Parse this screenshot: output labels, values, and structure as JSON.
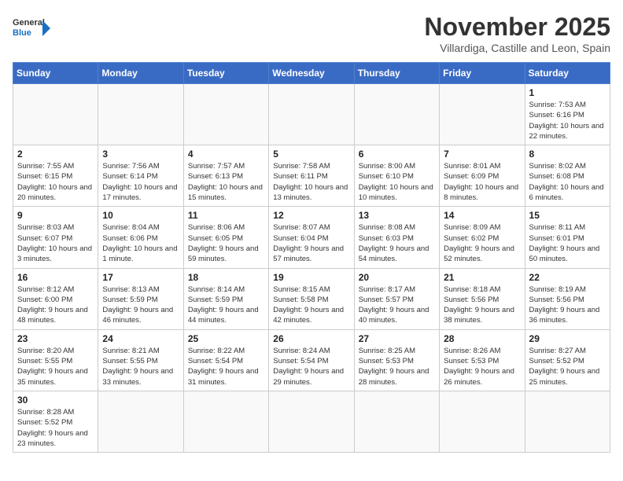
{
  "header": {
    "logo_general": "General",
    "logo_blue": "Blue",
    "month_title": "November 2025",
    "location": "Villardiga, Castille and Leon, Spain"
  },
  "weekdays": [
    "Sunday",
    "Monday",
    "Tuesday",
    "Wednesday",
    "Thursday",
    "Friday",
    "Saturday"
  ],
  "weeks": [
    [
      {
        "day": "",
        "info": ""
      },
      {
        "day": "",
        "info": ""
      },
      {
        "day": "",
        "info": ""
      },
      {
        "day": "",
        "info": ""
      },
      {
        "day": "",
        "info": ""
      },
      {
        "day": "",
        "info": ""
      },
      {
        "day": "1",
        "info": "Sunrise: 7:53 AM\nSunset: 6:16 PM\nDaylight: 10 hours and 22 minutes."
      }
    ],
    [
      {
        "day": "2",
        "info": "Sunrise: 7:55 AM\nSunset: 6:15 PM\nDaylight: 10 hours and 20 minutes."
      },
      {
        "day": "3",
        "info": "Sunrise: 7:56 AM\nSunset: 6:14 PM\nDaylight: 10 hours and 17 minutes."
      },
      {
        "day": "4",
        "info": "Sunrise: 7:57 AM\nSunset: 6:13 PM\nDaylight: 10 hours and 15 minutes."
      },
      {
        "day": "5",
        "info": "Sunrise: 7:58 AM\nSunset: 6:11 PM\nDaylight: 10 hours and 13 minutes."
      },
      {
        "day": "6",
        "info": "Sunrise: 8:00 AM\nSunset: 6:10 PM\nDaylight: 10 hours and 10 minutes."
      },
      {
        "day": "7",
        "info": "Sunrise: 8:01 AM\nSunset: 6:09 PM\nDaylight: 10 hours and 8 minutes."
      },
      {
        "day": "8",
        "info": "Sunrise: 8:02 AM\nSunset: 6:08 PM\nDaylight: 10 hours and 6 minutes."
      }
    ],
    [
      {
        "day": "9",
        "info": "Sunrise: 8:03 AM\nSunset: 6:07 PM\nDaylight: 10 hours and 3 minutes."
      },
      {
        "day": "10",
        "info": "Sunrise: 8:04 AM\nSunset: 6:06 PM\nDaylight: 10 hours and 1 minute."
      },
      {
        "day": "11",
        "info": "Sunrise: 8:06 AM\nSunset: 6:05 PM\nDaylight: 9 hours and 59 minutes."
      },
      {
        "day": "12",
        "info": "Sunrise: 8:07 AM\nSunset: 6:04 PM\nDaylight: 9 hours and 57 minutes."
      },
      {
        "day": "13",
        "info": "Sunrise: 8:08 AM\nSunset: 6:03 PM\nDaylight: 9 hours and 54 minutes."
      },
      {
        "day": "14",
        "info": "Sunrise: 8:09 AM\nSunset: 6:02 PM\nDaylight: 9 hours and 52 minutes."
      },
      {
        "day": "15",
        "info": "Sunrise: 8:11 AM\nSunset: 6:01 PM\nDaylight: 9 hours and 50 minutes."
      }
    ],
    [
      {
        "day": "16",
        "info": "Sunrise: 8:12 AM\nSunset: 6:00 PM\nDaylight: 9 hours and 48 minutes."
      },
      {
        "day": "17",
        "info": "Sunrise: 8:13 AM\nSunset: 5:59 PM\nDaylight: 9 hours and 46 minutes."
      },
      {
        "day": "18",
        "info": "Sunrise: 8:14 AM\nSunset: 5:59 PM\nDaylight: 9 hours and 44 minutes."
      },
      {
        "day": "19",
        "info": "Sunrise: 8:15 AM\nSunset: 5:58 PM\nDaylight: 9 hours and 42 minutes."
      },
      {
        "day": "20",
        "info": "Sunrise: 8:17 AM\nSunset: 5:57 PM\nDaylight: 9 hours and 40 minutes."
      },
      {
        "day": "21",
        "info": "Sunrise: 8:18 AM\nSunset: 5:56 PM\nDaylight: 9 hours and 38 minutes."
      },
      {
        "day": "22",
        "info": "Sunrise: 8:19 AM\nSunset: 5:56 PM\nDaylight: 9 hours and 36 minutes."
      }
    ],
    [
      {
        "day": "23",
        "info": "Sunrise: 8:20 AM\nSunset: 5:55 PM\nDaylight: 9 hours and 35 minutes."
      },
      {
        "day": "24",
        "info": "Sunrise: 8:21 AM\nSunset: 5:55 PM\nDaylight: 9 hours and 33 minutes."
      },
      {
        "day": "25",
        "info": "Sunrise: 8:22 AM\nSunset: 5:54 PM\nDaylight: 9 hours and 31 minutes."
      },
      {
        "day": "26",
        "info": "Sunrise: 8:24 AM\nSunset: 5:54 PM\nDaylight: 9 hours and 29 minutes."
      },
      {
        "day": "27",
        "info": "Sunrise: 8:25 AM\nSunset: 5:53 PM\nDaylight: 9 hours and 28 minutes."
      },
      {
        "day": "28",
        "info": "Sunrise: 8:26 AM\nSunset: 5:53 PM\nDaylight: 9 hours and 26 minutes."
      },
      {
        "day": "29",
        "info": "Sunrise: 8:27 AM\nSunset: 5:52 PM\nDaylight: 9 hours and 25 minutes."
      }
    ],
    [
      {
        "day": "30",
        "info": "Sunrise: 8:28 AM\nSunset: 5:52 PM\nDaylight: 9 hours and 23 minutes."
      },
      {
        "day": "",
        "info": ""
      },
      {
        "day": "",
        "info": ""
      },
      {
        "day": "",
        "info": ""
      },
      {
        "day": "",
        "info": ""
      },
      {
        "day": "",
        "info": ""
      },
      {
        "day": "",
        "info": ""
      }
    ]
  ]
}
